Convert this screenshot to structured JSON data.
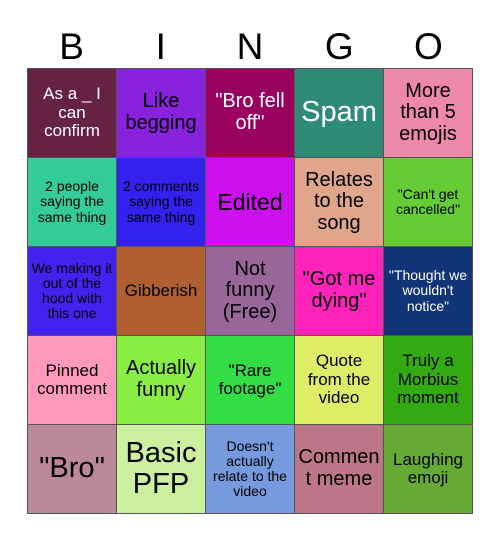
{
  "card": {
    "type": "bingo-card",
    "title_letters": [
      "B",
      "I",
      "N",
      "G",
      "O"
    ],
    "grid_size": 5,
    "background_color": "#ffffff",
    "border_color": "#555555",
    "columns": [
      {
        "letter": "B",
        "cells": [
          {
            "text": "As a _ I can confirm",
            "bg": "#662244",
            "fg": "#ffffff",
            "size": "sm"
          },
          {
            "text": "2 people saying the same thing",
            "bg": "#33cc99",
            "fg": "#000000",
            "size": "xs"
          },
          {
            "text": "We making it out of the hood with this one",
            "bg": "#4422ee",
            "fg": "#000000",
            "size": "xs"
          },
          {
            "text": "Pinned comment",
            "bg": "#ff99bb",
            "fg": "#000000",
            "size": "sm"
          },
          {
            "text": "\"Bro\"",
            "bg": "#bb8899",
            "fg": "#000000",
            "size": "xl"
          }
        ]
      },
      {
        "letter": "I",
        "cells": [
          {
            "text": "Like begging",
            "bg": "#8822dd",
            "fg": "#000000",
            "size": "md"
          },
          {
            "text": "2 comments saying the same thing",
            "bg": "#3322ee",
            "fg": "#000000",
            "size": "xs"
          },
          {
            "text": "Gibberish",
            "bg": "#b06030",
            "fg": "#000000",
            "size": "sm"
          },
          {
            "text": "Actually funny",
            "bg": "#88ee44",
            "fg": "#000000",
            "size": "md"
          },
          {
            "text": "Basic PFP",
            "bg": "#ccf0a0",
            "fg": "#000000",
            "size": "xl"
          }
        ]
      },
      {
        "letter": "N",
        "cells": [
          {
            "text": "\"Bro fell off\"",
            "bg": "#99005f",
            "fg": "#ffffff",
            "size": "md"
          },
          {
            "text": "Edited",
            "bg": "#cc11ee",
            "fg": "#000000",
            "size": "lg"
          },
          {
            "text": "Not funny (Free)",
            "bg": "#996699",
            "fg": "#000000",
            "size": "md"
          },
          {
            "text": "\"Rare footage\"",
            "bg": "#33dd44",
            "fg": "#000000",
            "size": "sm"
          },
          {
            "text": "Doesn't actually relate to the video",
            "bg": "#7799dd",
            "fg": "#000000",
            "size": "xs"
          }
        ]
      },
      {
        "letter": "G",
        "cells": [
          {
            "text": "Spam",
            "bg": "#2e8b78",
            "fg": "#ffffff",
            "size": "xl"
          },
          {
            "text": "Relates to the song",
            "bg": "#dfa68c",
            "fg": "#000000",
            "size": "md"
          },
          {
            "text": "\"Got me dying\"",
            "bg": "#ff22bb",
            "fg": "#000000",
            "size": "md"
          },
          {
            "text": "Quote from the video",
            "bg": "#ddee66",
            "fg": "#000000",
            "size": "sm"
          },
          {
            "text": "Comment meme",
            "bg": "#bb7788",
            "fg": "#000000",
            "size": "md"
          }
        ]
      },
      {
        "letter": "O",
        "cells": [
          {
            "text": "More than 5 emojis",
            "bg": "#ee88aa",
            "fg": "#000000",
            "size": "md"
          },
          {
            "text": "\"Can't get cancelled\"",
            "bg": "#66cc33",
            "fg": "#000000",
            "size": "xs"
          },
          {
            "text": "\"Thought we wouldn't notice\"",
            "bg": "#113377",
            "fg": "#ffffff",
            "size": "xs"
          },
          {
            "text": "Truly a Morbius moment",
            "bg": "#33aa11",
            "fg": "#000000",
            "size": "sm"
          },
          {
            "text": "Laughing emoji",
            "bg": "#66aa33",
            "fg": "#000000",
            "size": "sm"
          }
        ]
      }
    ]
  }
}
